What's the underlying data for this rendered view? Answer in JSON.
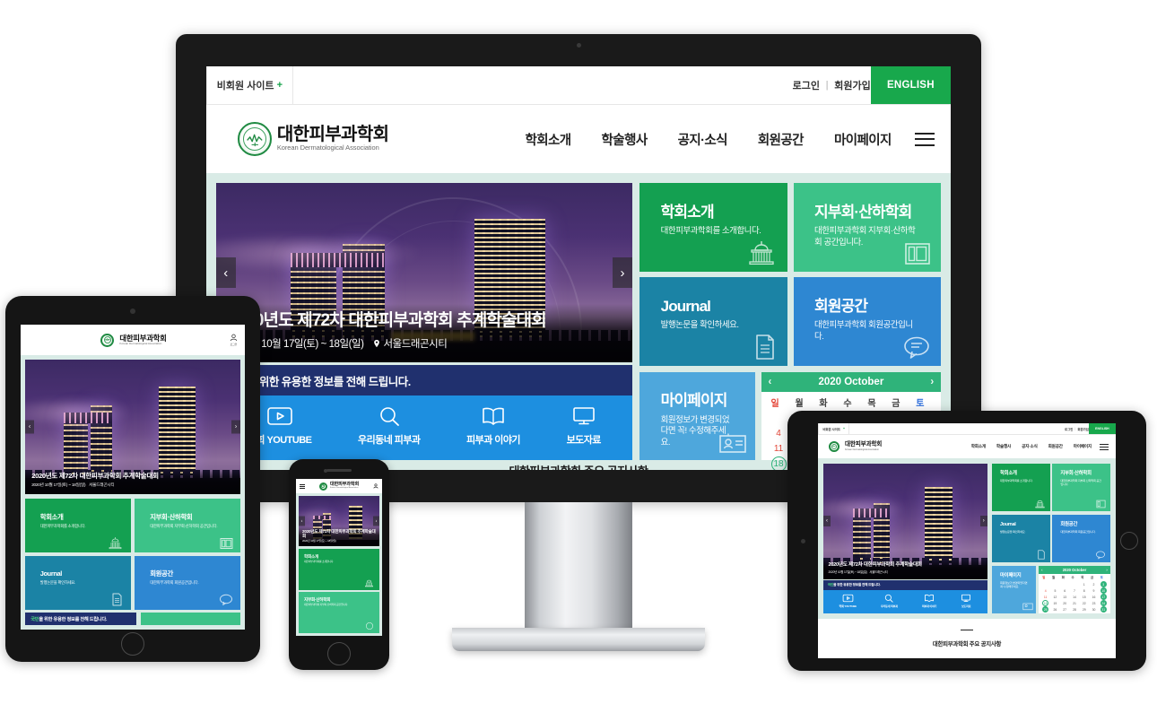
{
  "site": {
    "utility": {
      "nonmember_site": "비회원 사이트",
      "nonmember_plus": "+",
      "login": "로그인",
      "separator": "|",
      "join": "회원가입",
      "english": "ENGLISH"
    },
    "logo": {
      "name_kr": "대한피부과학회",
      "name_en": "Korean Dermatological Association",
      "emblem_icon": "dermatology-seal-icon"
    },
    "nav": [
      {
        "label": "학회소개"
      },
      {
        "label": "학술행사"
      },
      {
        "label": "공지·소식"
      },
      {
        "label": "회원공간"
      },
      {
        "label": "마이페이지"
      }
    ],
    "menu_icon": "hamburger-menu-icon",
    "hero": {
      "title": "2020년도 제72차 대한피부과학회 추계학술대회",
      "date": "2020년 10월 17일(토) ~ 18일(일)",
      "location": "서울드래곤시티",
      "location_icon": "map-pin-icon",
      "prev_icon": "chevron-left-icon",
      "next_icon": "chevron-right-icon",
      "prev_label": "‹",
      "next_label": "›"
    },
    "info": {
      "highlight": "국민",
      "text": "을 위한 유용한 정보를 전해 드립니다.",
      "items": [
        {
          "label": "학회 YOUTUBE",
          "icon": "play-video-icon"
        },
        {
          "label": "우리동네 피부과",
          "icon": "search-icon"
        },
        {
          "label": "피부과 이야기",
          "icon": "open-book-icon"
        },
        {
          "label": "보도자료",
          "icon": "monitor-icon"
        }
      ]
    },
    "tiles": [
      {
        "title": "학회소개",
        "desc": "대한피부과학회를 소개합니다.",
        "icon": "institution-building-icon",
        "color": "#14a051"
      },
      {
        "title": "지부회·산하학회",
        "desc": "대한피부과학회 지부회·산하학회 공간입니다.",
        "icon": "layout-panels-icon",
        "color": "#3cc288"
      },
      {
        "title": "Journal",
        "desc": "발행논문을 확인하세요.",
        "icon": "document-page-icon",
        "color": "#1b83a5"
      },
      {
        "title": "회원공간",
        "desc": "대한피부과학회 회원공간입니다.",
        "icon": "speech-bubble-icon",
        "color": "#2e87d2"
      },
      {
        "title": "마이페이지",
        "desc": "회원정보가 변경되었다면 꼭! 수정해주세요.",
        "icon": "id-card-icon",
        "color": "#4ea7dc"
      }
    ],
    "calendar": {
      "title": "2020 October",
      "prev_icon": "chevron-left-icon",
      "next_icon": "chevron-right-icon",
      "prev_label": "‹",
      "next_label": "›",
      "weekdays": [
        "일",
        "월",
        "화",
        "수",
        "목",
        "금",
        "토"
      ],
      "weeks": [
        [
          "",
          "",
          "",
          "",
          "1",
          "2",
          "3"
        ],
        [
          "4",
          "5",
          "6",
          "7",
          "8",
          "9",
          "10"
        ],
        [
          "11",
          "12",
          "13",
          "14",
          "15",
          "16",
          "17"
        ],
        [
          "18",
          "19",
          "20",
          "21",
          "22",
          "23",
          "24"
        ],
        [
          "25",
          "26",
          "27",
          "28",
          "29",
          "30",
          "31"
        ]
      ],
      "today": "18",
      "event_days": [
        "3",
        "10",
        "17",
        "18",
        "24",
        "25",
        "31"
      ]
    },
    "notice": {
      "title": "대한피부과학회 주요 공지사항"
    },
    "mobile_header": {
      "menu_icon": "hamburger-menu-icon",
      "account_icon": "user-account-icon",
      "account_label": "로그인"
    }
  },
  "devices": [
    {
      "name": "imac",
      "brand_icon": "apple-logo-icon",
      "brand_glyph": ""
    },
    {
      "name": "tablet-portrait"
    },
    {
      "name": "phone"
    },
    {
      "name": "tablet-landscape"
    }
  ],
  "colors": {
    "brand_green": "#18a84c",
    "tile_green": "#14a051",
    "tile_mint": "#3cc288",
    "tile_teal": "#1b83a5",
    "tile_blue": "#2e87d2",
    "tile_lightblue": "#4ea7dc",
    "info_navy": "#20306e",
    "info_blue": "#1d8fe0",
    "page_bg": "#d9ebe6",
    "calendar_green": "#2fb37a"
  }
}
